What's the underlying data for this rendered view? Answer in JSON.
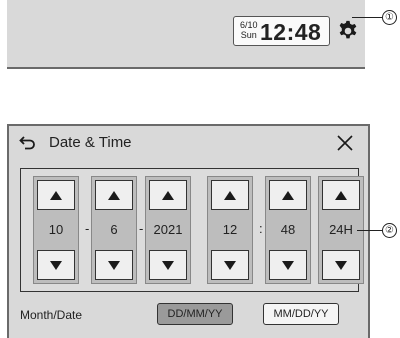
{
  "statusbar": {
    "date_month_day": "6/10",
    "date_weekday": "Sun",
    "time": "12:48",
    "icons": {
      "settings": "gear-icon"
    }
  },
  "callouts": [
    "①",
    "②"
  ],
  "dialog": {
    "title": "Date & Time",
    "icons": {
      "back": "back-arrow-icon",
      "close": "close-icon"
    },
    "pickers": [
      {
        "name": "day",
        "value": "10"
      },
      {
        "name": "month",
        "value": "6"
      },
      {
        "name": "year",
        "value": "2021"
      },
      {
        "name": "hour",
        "value": "12"
      },
      {
        "name": "minute",
        "value": "48"
      },
      {
        "name": "clock-format",
        "value": "24H"
      }
    ],
    "separators": [
      "-",
      "-",
      ":"
    ],
    "month_date_label": "Month/Date",
    "format_options": [
      {
        "label": "DD/MM/YY",
        "selected": true
      },
      {
        "label": "MM/DD/YY",
        "selected": false
      }
    ]
  }
}
